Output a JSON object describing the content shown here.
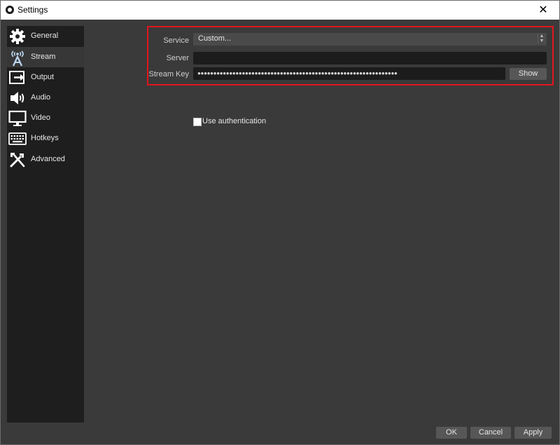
{
  "window": {
    "title": "Settings",
    "close_glyph": "✕"
  },
  "sidebar": {
    "items": [
      {
        "label": "General",
        "icon": "gear-icon"
      },
      {
        "label": "Stream",
        "icon": "broadcast-tower-icon"
      },
      {
        "label": "Output",
        "icon": "output-icon"
      },
      {
        "label": "Audio",
        "icon": "speaker-icon"
      },
      {
        "label": "Video",
        "icon": "monitor-icon"
      },
      {
        "label": "Hotkeys",
        "icon": "keyboard-icon"
      },
      {
        "label": "Advanced",
        "icon": "tools-icon"
      }
    ],
    "active": "Stream"
  },
  "stream": {
    "service_label": "Service",
    "service_value": "Custom...",
    "server_label": "Server",
    "server_value": "",
    "stream_key_label": "Stream Key",
    "stream_key_value": "●●●●●●●●●●●●●●●●●●●●●●●●●●●●●●●●●●●●●●●●●●●●●●●●●●●●●●●●●●●●●●●",
    "show_button": "Show",
    "use_authentication_label": "Use authentication",
    "use_authentication_checked": false
  },
  "footer": {
    "ok_label": "OK",
    "cancel_label": "Cancel",
    "apply_label": "Apply"
  },
  "colors": {
    "highlight_border": "#e0161d",
    "sidebar_bg": "#1e1e1e",
    "panel_bg": "#3a3a3a"
  }
}
